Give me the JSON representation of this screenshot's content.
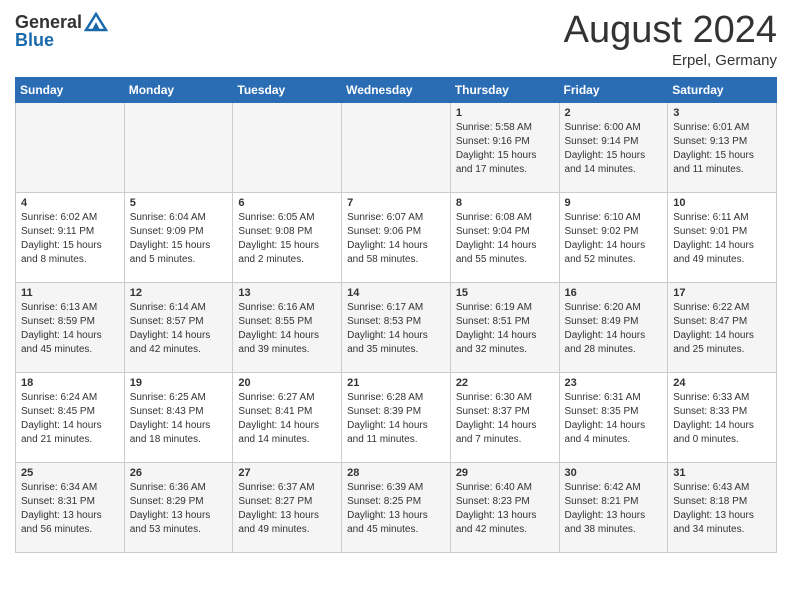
{
  "header": {
    "logo_general": "General",
    "logo_blue": "Blue",
    "month_year": "August 2024",
    "location": "Erpel, Germany"
  },
  "days_of_week": [
    "Sunday",
    "Monday",
    "Tuesday",
    "Wednesday",
    "Thursday",
    "Friday",
    "Saturday"
  ],
  "weeks": [
    [
      {
        "day": "",
        "info": ""
      },
      {
        "day": "",
        "info": ""
      },
      {
        "day": "",
        "info": ""
      },
      {
        "day": "",
        "info": ""
      },
      {
        "day": "1",
        "info": "Sunrise: 5:58 AM\nSunset: 9:16 PM\nDaylight: 15 hours and 17 minutes."
      },
      {
        "day": "2",
        "info": "Sunrise: 6:00 AM\nSunset: 9:14 PM\nDaylight: 15 hours and 14 minutes."
      },
      {
        "day": "3",
        "info": "Sunrise: 6:01 AM\nSunset: 9:13 PM\nDaylight: 15 hours and 11 minutes."
      }
    ],
    [
      {
        "day": "4",
        "info": "Sunrise: 6:02 AM\nSunset: 9:11 PM\nDaylight: 15 hours and 8 minutes."
      },
      {
        "day": "5",
        "info": "Sunrise: 6:04 AM\nSunset: 9:09 PM\nDaylight: 15 hours and 5 minutes."
      },
      {
        "day": "6",
        "info": "Sunrise: 6:05 AM\nSunset: 9:08 PM\nDaylight: 15 hours and 2 minutes."
      },
      {
        "day": "7",
        "info": "Sunrise: 6:07 AM\nSunset: 9:06 PM\nDaylight: 14 hours and 58 minutes."
      },
      {
        "day": "8",
        "info": "Sunrise: 6:08 AM\nSunset: 9:04 PM\nDaylight: 14 hours and 55 minutes."
      },
      {
        "day": "9",
        "info": "Sunrise: 6:10 AM\nSunset: 9:02 PM\nDaylight: 14 hours and 52 minutes."
      },
      {
        "day": "10",
        "info": "Sunrise: 6:11 AM\nSunset: 9:01 PM\nDaylight: 14 hours and 49 minutes."
      }
    ],
    [
      {
        "day": "11",
        "info": "Sunrise: 6:13 AM\nSunset: 8:59 PM\nDaylight: 14 hours and 45 minutes."
      },
      {
        "day": "12",
        "info": "Sunrise: 6:14 AM\nSunset: 8:57 PM\nDaylight: 14 hours and 42 minutes."
      },
      {
        "day": "13",
        "info": "Sunrise: 6:16 AM\nSunset: 8:55 PM\nDaylight: 14 hours and 39 minutes."
      },
      {
        "day": "14",
        "info": "Sunrise: 6:17 AM\nSunset: 8:53 PM\nDaylight: 14 hours and 35 minutes."
      },
      {
        "day": "15",
        "info": "Sunrise: 6:19 AM\nSunset: 8:51 PM\nDaylight: 14 hours and 32 minutes."
      },
      {
        "day": "16",
        "info": "Sunrise: 6:20 AM\nSunset: 8:49 PM\nDaylight: 14 hours and 28 minutes."
      },
      {
        "day": "17",
        "info": "Sunrise: 6:22 AM\nSunset: 8:47 PM\nDaylight: 14 hours and 25 minutes."
      }
    ],
    [
      {
        "day": "18",
        "info": "Sunrise: 6:24 AM\nSunset: 8:45 PM\nDaylight: 14 hours and 21 minutes."
      },
      {
        "day": "19",
        "info": "Sunrise: 6:25 AM\nSunset: 8:43 PM\nDaylight: 14 hours and 18 minutes."
      },
      {
        "day": "20",
        "info": "Sunrise: 6:27 AM\nSunset: 8:41 PM\nDaylight: 14 hours and 14 minutes."
      },
      {
        "day": "21",
        "info": "Sunrise: 6:28 AM\nSunset: 8:39 PM\nDaylight: 14 hours and 11 minutes."
      },
      {
        "day": "22",
        "info": "Sunrise: 6:30 AM\nSunset: 8:37 PM\nDaylight: 14 hours and 7 minutes."
      },
      {
        "day": "23",
        "info": "Sunrise: 6:31 AM\nSunset: 8:35 PM\nDaylight: 14 hours and 4 minutes."
      },
      {
        "day": "24",
        "info": "Sunrise: 6:33 AM\nSunset: 8:33 PM\nDaylight: 14 hours and 0 minutes."
      }
    ],
    [
      {
        "day": "25",
        "info": "Sunrise: 6:34 AM\nSunset: 8:31 PM\nDaylight: 13 hours and 56 minutes."
      },
      {
        "day": "26",
        "info": "Sunrise: 6:36 AM\nSunset: 8:29 PM\nDaylight: 13 hours and 53 minutes."
      },
      {
        "day": "27",
        "info": "Sunrise: 6:37 AM\nSunset: 8:27 PM\nDaylight: 13 hours and 49 minutes."
      },
      {
        "day": "28",
        "info": "Sunrise: 6:39 AM\nSunset: 8:25 PM\nDaylight: 13 hours and 45 minutes."
      },
      {
        "day": "29",
        "info": "Sunrise: 6:40 AM\nSunset: 8:23 PM\nDaylight: 13 hours and 42 minutes."
      },
      {
        "day": "30",
        "info": "Sunrise: 6:42 AM\nSunset: 8:21 PM\nDaylight: 13 hours and 38 minutes."
      },
      {
        "day": "31",
        "info": "Sunrise: 6:43 AM\nSunset: 8:18 PM\nDaylight: 13 hours and 34 minutes."
      }
    ]
  ]
}
